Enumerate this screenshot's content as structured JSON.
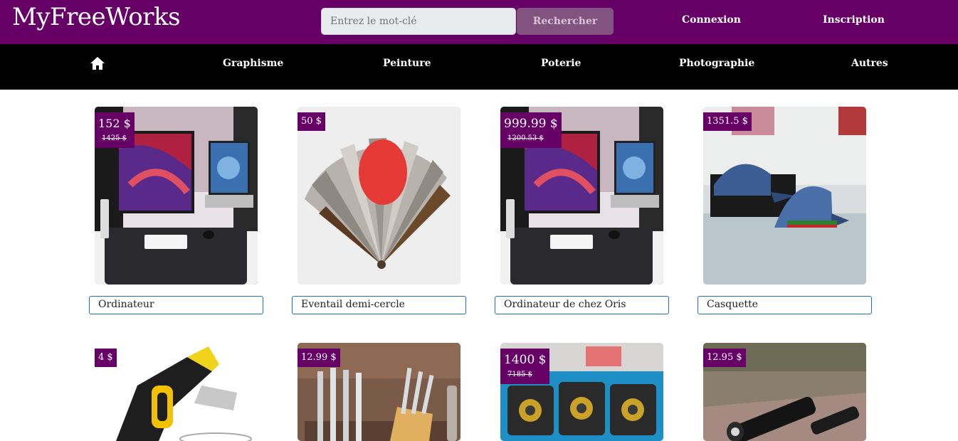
{
  "header": {
    "logo": "MyFreeWorks",
    "search_placeholder": "Entrez le mot-clé",
    "search_button": "Rechercher",
    "login": "Connexion",
    "signup": "Inscription"
  },
  "nav": {
    "home_icon": "home-icon",
    "items": [
      "Graphisme",
      "Peinture",
      "Poterie",
      "Photographie",
      "Autres"
    ]
  },
  "colors": {
    "brand": "#660066",
    "navbar": "#000000",
    "title_border": "#1c6fc2"
  },
  "products": [
    {
      "title": "Ordinateur",
      "price": "152 $",
      "old_price": "1425 $"
    },
    {
      "title": "Eventail demi-cercle",
      "price": "50 $",
      "old_price": ""
    },
    {
      "title": "Ordinateur de chez Oris",
      "price": "999.99 $",
      "old_price": "1200.53 $"
    },
    {
      "title": "Casquette",
      "price": "1351.5 $",
      "old_price": ""
    },
    {
      "title": "",
      "price": "4 $",
      "old_price": ""
    },
    {
      "title": "",
      "price": "12.99 $",
      "old_price": ""
    },
    {
      "title": "",
      "price": "1400 $",
      "old_price": "7185 $"
    },
    {
      "title": "",
      "price": "12.95 $",
      "old_price": ""
    }
  ]
}
